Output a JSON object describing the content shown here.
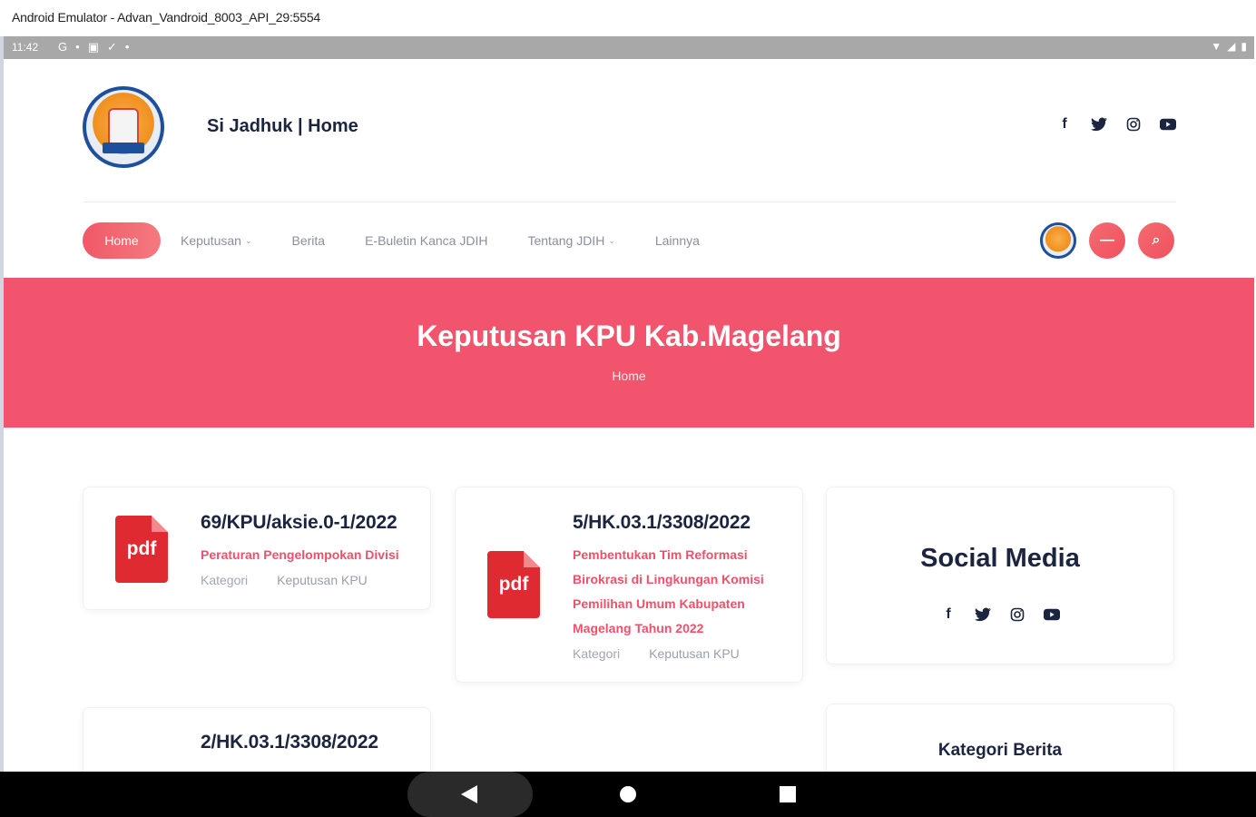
{
  "window": {
    "title": "Android Emulator - Advan_Vandroid_8003_API_29:5554"
  },
  "statusbar": {
    "time": "11:42",
    "icons": [
      "G",
      "•",
      "▣",
      "✓",
      "•"
    ],
    "right_icons": [
      "▼",
      "◢",
      "▮"
    ]
  },
  "header": {
    "site_title": "Si Jadhuk | Home",
    "social": [
      {
        "icon": "facebook-icon",
        "glyph": "f"
      },
      {
        "icon": "twitter-icon",
        "glyph": "🐦"
      },
      {
        "icon": "instagram-icon",
        "glyph": "◎"
      },
      {
        "icon": "youtube-icon",
        "glyph": "▶"
      }
    ]
  },
  "nav": {
    "home": "Home",
    "items": [
      {
        "label": "Keputusan",
        "has_dropdown": true
      },
      {
        "label": "Berita",
        "has_dropdown": false
      },
      {
        "label": "E-Buletin Kanca JDIH",
        "has_dropdown": false
      },
      {
        "label": "Tentang JDIH",
        "has_dropdown": true
      },
      {
        "label": "Lainnya",
        "has_dropdown": false
      }
    ],
    "chevron": "⌄",
    "menu_glyph": "—",
    "search_glyph": "⌕"
  },
  "banner": {
    "title": "Keputusan KPU Kab.Magelang",
    "breadcrumb": "Home"
  },
  "cards": [
    {
      "number": "69/KPU/aksie.0-1/2022",
      "description": "Peraturan Pengelompokan Divisi",
      "category_label": "Kategori",
      "category": "Keputusan KPU",
      "pdf_label": "pdf"
    },
    {
      "number": "5/HK.03.1/3308/2022",
      "description_lines": [
        "Pembentukan Tim Reformasi",
        "Birokrasi di Lingkungan Komisi",
        "Pemilihan Umum Kabupaten",
        "Magelang Tahun 2022"
      ],
      "category_label": "Kategori",
      "category": "Keputusan KPU",
      "pdf_label": "pdf"
    },
    {
      "number": "2/HK.03.1/3308/2022"
    }
  ],
  "sidebar": {
    "social_title": "Social Media",
    "kategori_title": "Kategori Berita"
  },
  "colors": {
    "accent": "#f3546d",
    "pdf_red": "#e02a32",
    "navy": "#1b2540"
  }
}
